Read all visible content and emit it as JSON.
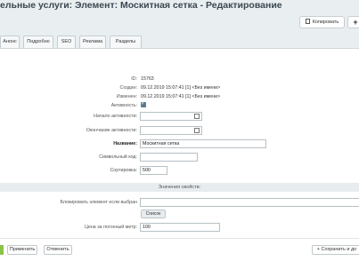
{
  "header": {
    "title": "ельные услуги: Элемент: Москитная сетка - Редактирование",
    "star_icon": "star-icon",
    "copy_label": "Копировать",
    "plus_label": "+"
  },
  "tabs": [
    "Анонс",
    "Подробно",
    "SEO",
    "Реклама",
    "Разделы"
  ],
  "form": {
    "id_label": "ID:",
    "id_value": "15763",
    "created_label": "Создан:",
    "created_value": "09.12.2019 15:07:41",
    "created_user": "[1] <Без имени>",
    "changed_label": "Изменен:",
    "changed_value": "09.12.2019 15:07:41",
    "changed_user": "[1] <Без имени>",
    "active_label": "Активность:",
    "active_checked": true,
    "start_label": "Начало активности:",
    "end_label": "Окончание активности:",
    "name_label": "Название:",
    "name_value": "Москитная сетка",
    "code_label": "Символьный код:",
    "code_value": "",
    "sort_label": "Сортировка:",
    "sort_value": "500"
  },
  "properties": {
    "section_title": "Значения свойств:",
    "block_label": "Блокировать элемент если выбран",
    "list_button": "Список",
    "price_label": "Цена за погонный метр:",
    "price_value": "100"
  },
  "footer": {
    "apply": "Применить",
    "cancel": "Отменить",
    "save_add": "+ Сохранить и до"
  }
}
